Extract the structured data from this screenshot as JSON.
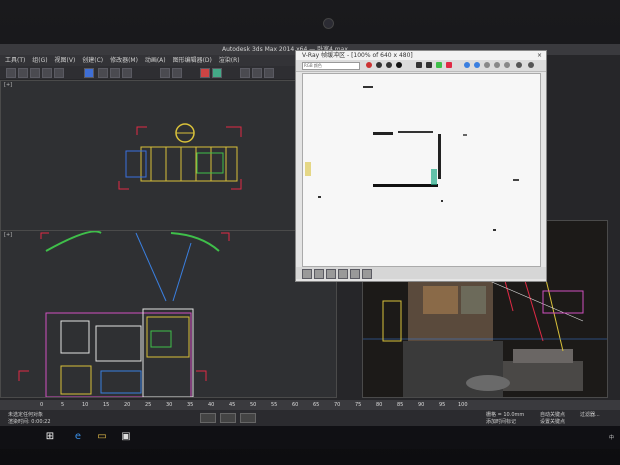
{
  "app": {
    "title": "Autodesk 3ds Max  2014 x64 — 卧室4.max"
  },
  "menu": {
    "items": [
      "工具(T)",
      "组(G)",
      "视图(V)",
      "创建(C)",
      "修改器(M)",
      "动画(A)",
      "图形编辑器(D)",
      "渲染(R)",
      "自定义(U)"
    ]
  },
  "viewports": {
    "top_label": "[+]",
    "left_label": "[+]",
    "perspective_label": "[+]"
  },
  "vray": {
    "title": "V-Ray 帧缓冲区 - [100% of 640 x 480]",
    "channel": "RGB 颜色",
    "close": "×"
  },
  "timeline": {
    "ticks": [
      "0",
      "5",
      "10",
      "15",
      "20",
      "25",
      "30",
      "35",
      "40",
      "45",
      "50",
      "55",
      "60",
      "65",
      "70",
      "75",
      "80",
      "85",
      "90",
      "95",
      "100"
    ]
  },
  "status": {
    "line1": "未选定任何对象",
    "line2": "渲染时间: 0:00:22",
    "grid": "栅格 = 10.0mm",
    "add_key": "添加时间标记",
    "auto_key": "自动关键点",
    "set_key": "设置关键点",
    "filter": "过滤器..."
  },
  "taskbar": {
    "icons": [
      "windows-icon",
      "search-icon",
      "task-view-icon",
      "edge-icon",
      "explorer-icon",
      "3dsmax-icon"
    ],
    "time": "中"
  },
  "colors": {
    "viewport_bg": "#2f3033",
    "accent_yellow": "#d9c13a",
    "accent_red": "#e02a45",
    "accent_green": "#3fbf4a"
  }
}
